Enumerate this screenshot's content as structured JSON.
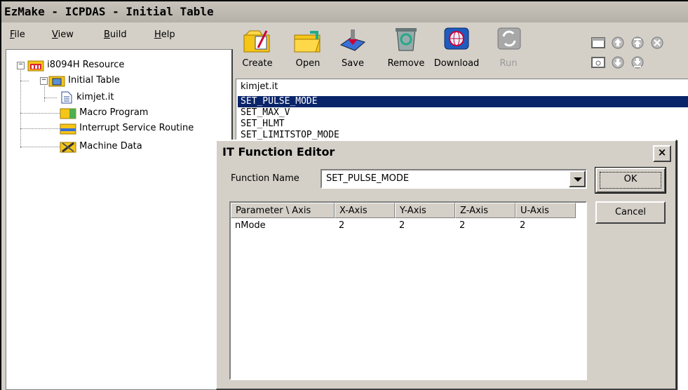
{
  "window": {
    "title": "EzMake - ICPDAS - Initial Table"
  },
  "menu": [
    {
      "label": "File",
      "key": "F"
    },
    {
      "label": "View",
      "key": "V"
    },
    {
      "label": "Build",
      "key": "B"
    },
    {
      "label": "Help",
      "key": "H"
    }
  ],
  "tree": {
    "root": "i8094H Resource",
    "initial_table": "Initial Table",
    "file": "kimjet.it",
    "macro_program": "Macro Program",
    "isr": "Interrupt Service Routine",
    "machine_data": "Machine Data"
  },
  "toolbar": {
    "create": "Create",
    "open": "Open",
    "save": "Save",
    "remove": "Remove",
    "download": "Download",
    "run": "Run"
  },
  "list": {
    "header": "kimjet.it",
    "rows": [
      "SET_PULSE_MODE",
      "SET_MAX_V",
      "SET_HLMT",
      "SET_LIMITSTOP_MODE"
    ],
    "selected_index": 0
  },
  "dialog": {
    "title": "IT Function Editor",
    "close_glyph": "×",
    "function_name_label": "Function Name",
    "function_name_value": "SET_PULSE_MODE",
    "ok_label": "OK",
    "cancel_label": "Cancel",
    "table": {
      "headers": [
        "Parameter \\ Axis",
        "X-Axis",
        "Y-Axis",
        "Z-Axis",
        "U-Axis"
      ],
      "rows": [
        [
          "nMode",
          "2",
          "2",
          "2",
          "2"
        ]
      ]
    }
  },
  "colors": {
    "selection": "#0a246a",
    "face": "#d4d0c8",
    "folder": "#f5c518"
  }
}
